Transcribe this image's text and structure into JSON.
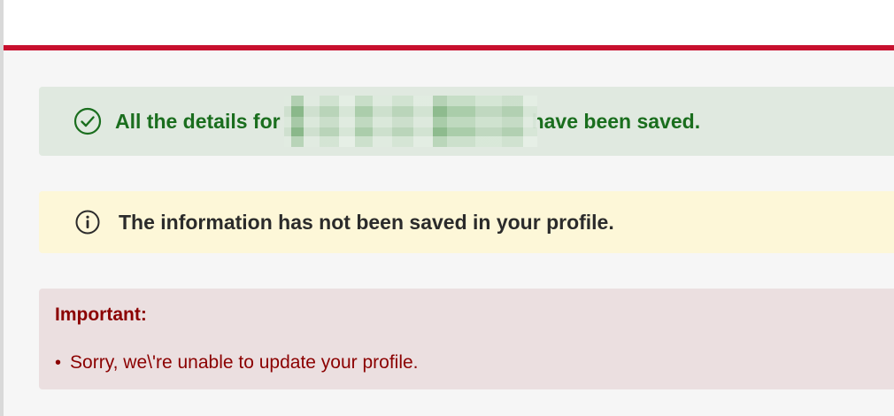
{
  "header": {
    "accent_color": "#c8102e"
  },
  "alerts": {
    "success": {
      "icon": "check-circle-icon",
      "text_before": "All the details for",
      "text_after": "have been saved.",
      "color": "#1a6e1e",
      "background": "#e0e9e0"
    },
    "warning": {
      "icon": "info-circle-icon",
      "text": "The information has not been saved in your profile.",
      "background": "#fdf7d8"
    },
    "error": {
      "title": "Important:",
      "items": [
        "Sorry, we\\'re unable to update your profile."
      ],
      "color": "#8b0000",
      "background": "#ebdfe0"
    }
  }
}
